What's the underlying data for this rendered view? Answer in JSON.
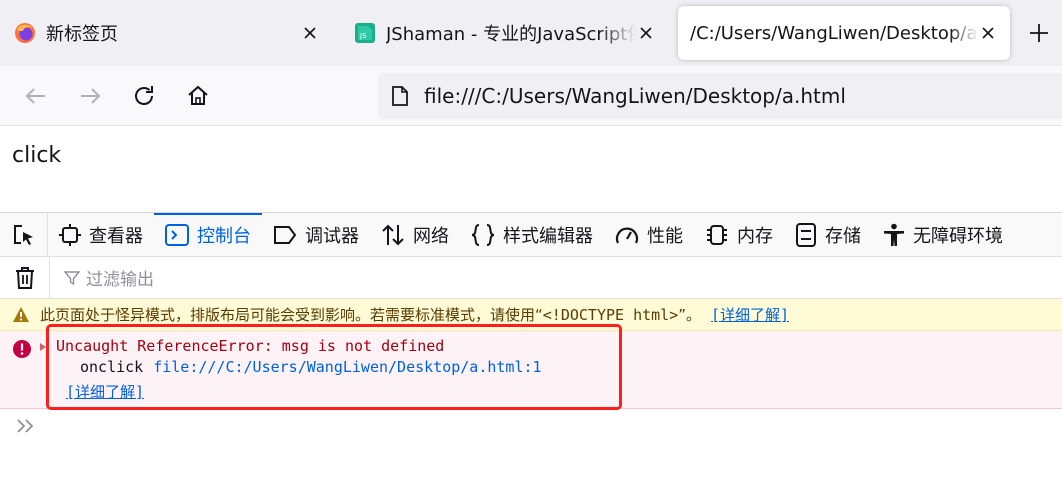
{
  "tabs": [
    {
      "title": "新标签页",
      "icon": "firefox-icon"
    },
    {
      "title": "JShaman - 专业的JavaScript保",
      "icon": "jshaman-js-icon"
    },
    {
      "title": "/C:/Users/WangLiwen/Desktop/a",
      "icon": ""
    }
  ],
  "address_bar": {
    "url": "file:///C:/Users/WangLiwen/Desktop/a.html"
  },
  "page": {
    "text": "click"
  },
  "devtools": {
    "tabs": [
      {
        "label": "查看器",
        "icon": "inspector-icon"
      },
      {
        "label": "控制台",
        "icon": "console-icon",
        "active": true
      },
      {
        "label": "调试器",
        "icon": "debugger-icon"
      },
      {
        "label": "网络",
        "icon": "network-icon"
      },
      {
        "label": "样式编辑器",
        "icon": "style-editor-icon"
      },
      {
        "label": "性能",
        "icon": "performance-icon"
      },
      {
        "label": "内存",
        "icon": "memory-icon"
      },
      {
        "label": "存储",
        "icon": "storage-icon"
      },
      {
        "label": "无障碍环境",
        "icon": "accessibility-icon"
      }
    ],
    "filter_placeholder": "过滤输出",
    "warning": {
      "text_before": "此页面处于怪异模式，排版布局可能会受到影响。若需要标准模式，请使用“",
      "doctype": "<!DOCTYPE html>",
      "text_after": "”。",
      "link": "[详细了解]"
    },
    "error": {
      "message": "Uncaught ReferenceError: msg is not defined",
      "frame_fn": "onclick",
      "frame_src": "file:///C:/Users/WangLiwen/Desktop/a.html:1",
      "link": "[详细了解]"
    }
  },
  "colors": {
    "accent": "#0061e0",
    "error": "#a4000f",
    "highlight": "#ff1e1e",
    "warning_bg": "#fffbd6"
  }
}
